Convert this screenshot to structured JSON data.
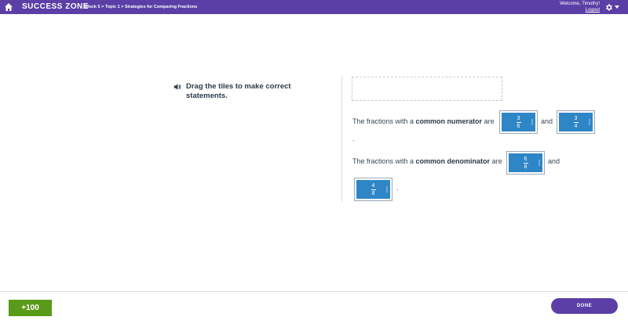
{
  "header": {
    "app_name": "SUCCESS ZONE",
    "breadcrumb": "Block 5 > Topic 1 > Strategies for Comparing Fractions",
    "welcome": "Welcome, Timothy!",
    "logout": "Logout"
  },
  "activity": {
    "instruction": "Drag the tiles to make correct statements.",
    "sentence1": {
      "prefix": "The fractions with a ",
      "bold": "common numerator",
      "suffix": " are",
      "and": "and",
      "end": "."
    },
    "sentence2": {
      "prefix": "The fractions with a ",
      "bold": "common denominator",
      "suffix": " are",
      "and": "and",
      "end": "."
    },
    "tiles": [
      {
        "numerator": "3",
        "denominator": "6"
      },
      {
        "numerator": "3",
        "denominator": "4"
      },
      {
        "numerator": "6",
        "denominator": "8"
      },
      {
        "numerator": "4",
        "denominator": "8"
      }
    ]
  },
  "footer": {
    "score_label": "+100",
    "done_label": "DONE"
  },
  "colors": {
    "brand": "#5b3fa6",
    "tile": "#2f86c6",
    "score": "#5a9a1a"
  }
}
